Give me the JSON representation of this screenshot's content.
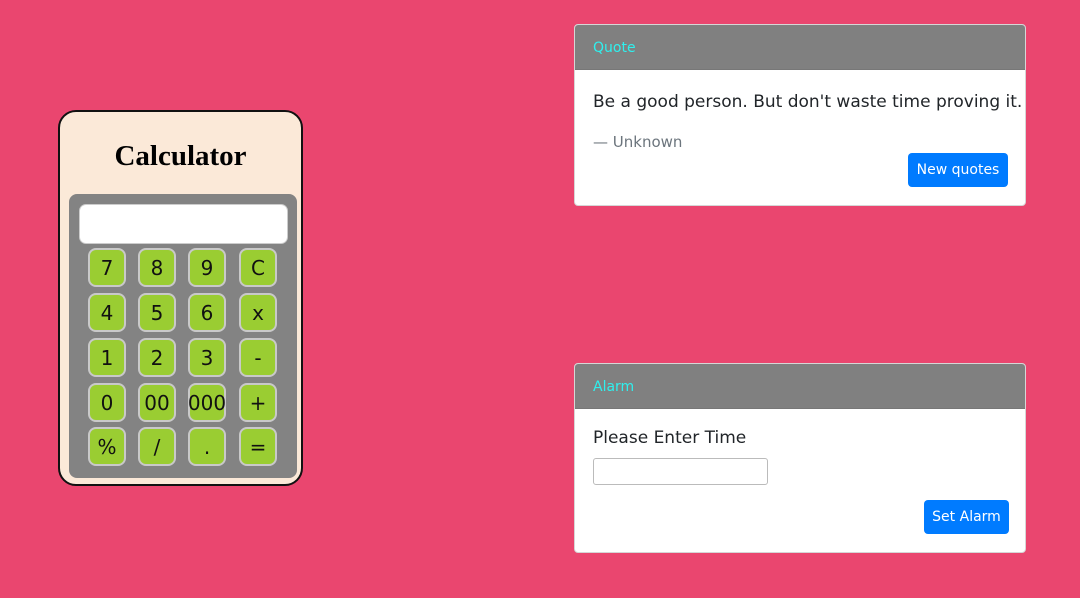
{
  "calculator": {
    "title": "Calculator",
    "display_value": "",
    "keys": [
      [
        "7",
        "8",
        "9",
        "C"
      ],
      [
        "4",
        "5",
        "6",
        "x"
      ],
      [
        "1",
        "2",
        "3",
        "-"
      ],
      [
        "0",
        "00",
        "000",
        "+"
      ],
      [
        "%",
        "/",
        ".",
        "="
      ]
    ]
  },
  "quote_card": {
    "header": "Quote",
    "text": "Be a good person. But don't waste time proving it.",
    "author": "— Unknown",
    "button_label": "New quotes"
  },
  "alarm_card": {
    "header": "Alarm",
    "label": "Please Enter Time",
    "input_value": "",
    "button_label": "Set Alarm"
  },
  "colors": {
    "background": "#ea466f",
    "key_green": "#9acd32",
    "header_text": "#2ef0ee",
    "primary_button": "#007bff"
  }
}
